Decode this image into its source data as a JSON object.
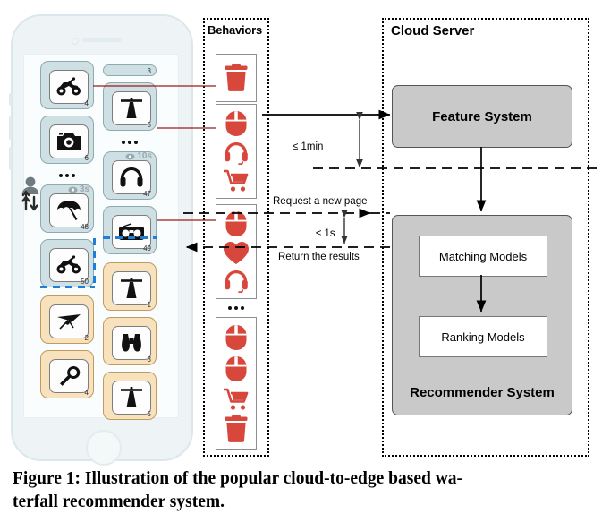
{
  "figure": {
    "caption_line1": "Figure 1: Illustration of the popular cloud-to-edge based wa-",
    "caption_line2": "terfall recommender system."
  },
  "colors": {
    "behavior_red": "#d7473b",
    "card_blue": "#cfe0e5",
    "card_tan": "#f8e2bd",
    "server_gray": "#c9c9c9",
    "cut_blue": "#1f7fd6",
    "connector_red": "#9b1b1b"
  },
  "phone": {
    "name": "smartphone-waterfall-feed",
    "user_glyph": "user-scroll-icon",
    "column_left": [
      {
        "num": "4",
        "icon": "atv-icon",
        "style": "blue",
        "badge": null
      },
      {
        "num": "6",
        "icon": "camera-icon",
        "style": "blue",
        "badge": null
      },
      {
        "num": "48",
        "icon": "umbrella-icon",
        "style": "blue",
        "badge": "3s"
      },
      {
        "num": "50",
        "icon": "atv-icon",
        "style": "blue",
        "badge": null
      },
      {
        "num": "2",
        "icon": "hangglider-icon",
        "style": "tan",
        "badge": null
      },
      {
        "num": "4",
        "icon": "wrench-icon",
        "style": "tan",
        "badge": null
      }
    ],
    "column_right": [
      {
        "num": "3",
        "icon": null,
        "style": "blue",
        "badge": null
      },
      {
        "num": "5",
        "icon": "lighthouse-icon",
        "style": "blue",
        "badge": null
      },
      {
        "num": "47",
        "icon": "headphone-icon",
        "style": "blue",
        "badge": "10s"
      },
      {
        "num": "49",
        "icon": "radio-icon",
        "style": "blue",
        "badge": null
      },
      {
        "num": "1",
        "icon": "lighthouse-icon",
        "style": "tan",
        "badge": null
      },
      {
        "num": "3",
        "icon": "binoculars-icon",
        "style": "tan",
        "badge": null
      },
      {
        "num": "5",
        "icon": "lighthouse-icon",
        "style": "tan",
        "badge": null
      }
    ],
    "ellipsis": "•••"
  },
  "behaviors": {
    "title": "Behaviors",
    "ellipsis": "•••",
    "groups": [
      {
        "name": "behavior-group-1",
        "icons": [
          "trash-icon"
        ]
      },
      {
        "name": "behavior-group-2",
        "icons": [
          "mouse-icon",
          "headphone-icon",
          "cart-icon"
        ]
      },
      {
        "name": "behavior-group-3",
        "icons": [
          "mouse-icon",
          "heart-icon",
          "headset-icon"
        ]
      },
      {
        "name": "behavior-group-4",
        "icons": [
          "mouse-icon",
          "mouse-icon",
          "cart-icon",
          "trash-icon"
        ]
      }
    ]
  },
  "cloud": {
    "title": "Cloud Server",
    "feature_system": "Feature System",
    "recommender_system": "Recommender System",
    "matching_models": "Matching Models",
    "ranking_models": "Ranking Models"
  },
  "annotations": {
    "latency_upload": "≤ 1min",
    "latency_request": "≤ 1s",
    "request_label": "Request a new page",
    "return_label": "Return the results"
  }
}
